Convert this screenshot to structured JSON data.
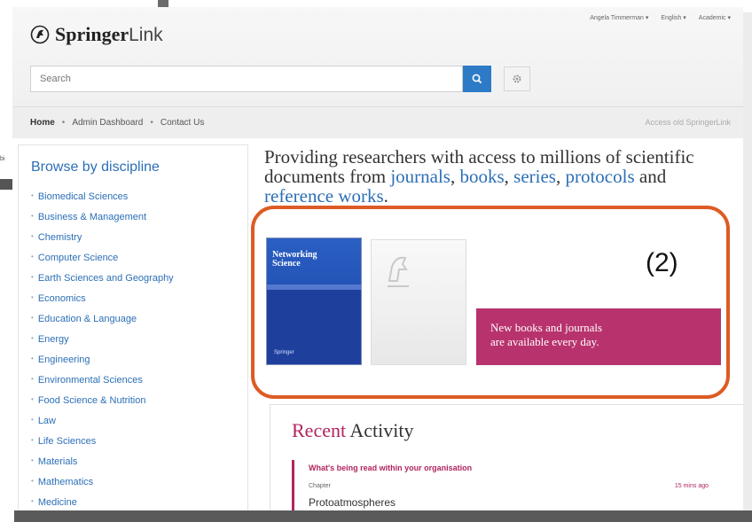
{
  "brand": {
    "name_bold": "Springer",
    "name_light": "Link"
  },
  "user_menu": [
    "Angela Timmerman",
    "English",
    "Academic"
  ],
  "search": {
    "placeholder": "Search"
  },
  "nav": {
    "home": "Home",
    "admin": "Admin Dashboard",
    "contact": "Contact Us",
    "access_old": "Access old SpringerLink"
  },
  "sidebar": {
    "title": "Browse by discipline",
    "items": [
      "Biomedical Sciences",
      "Business & Management",
      "Chemistry",
      "Computer Science",
      "Earth Sciences and Geography",
      "Economics",
      "Education & Language",
      "Energy",
      "Engineering",
      "Environmental Sciences",
      "Food Science & Nutrition",
      "Law",
      "Life Sciences",
      "Materials",
      "Mathematics",
      "Medicine"
    ]
  },
  "tagline": {
    "part1": "Providing researchers with access to millions of scientific documents from ",
    "journals": "journals",
    "comma": ", ",
    "books": "books",
    "comma2": ", ",
    "series": "series",
    "comma3": ", ",
    "protocols": "protocols",
    "and": " and ",
    "reference": "reference works",
    "end": "."
  },
  "promo": {
    "book_title": "Networking Science",
    "book_publisher": "Springer",
    "banner_line1": "New books and journals",
    "banner_line2": "are available every day."
  },
  "annotation": "(2)",
  "recent": {
    "title_accent": "Recent",
    "title_rest": " Activity",
    "heading": "What's being read within your organisation",
    "type": "Chapter",
    "time": "15 mins ago",
    "document": "Protoatmospheres"
  },
  "colors": {
    "link_blue": "#2c6fb6",
    "accent_magenta": "#b8336e",
    "annotation_orange": "#de5b25",
    "search_blue": "#2d7bc7"
  }
}
